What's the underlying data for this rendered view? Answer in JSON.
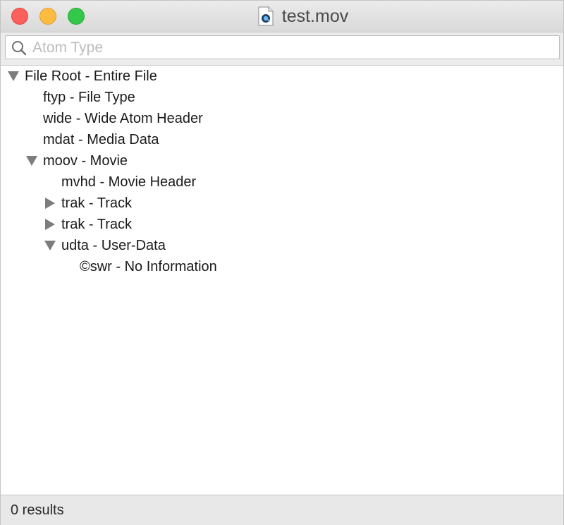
{
  "window": {
    "title": "test.mov",
    "file_icon": "quicktime-document-icon"
  },
  "search": {
    "placeholder": "Atom Type",
    "value": ""
  },
  "tree": {
    "rows": [
      {
        "label": "File Root - Entire File",
        "depth": 0,
        "state": "expanded"
      },
      {
        "label": "ftyp - File Type",
        "depth": 1,
        "state": "leaf"
      },
      {
        "label": "wide - Wide Atom Header",
        "depth": 1,
        "state": "leaf"
      },
      {
        "label": "mdat - Media Data",
        "depth": 1,
        "state": "leaf"
      },
      {
        "label": "moov - Movie",
        "depth": 1,
        "state": "expanded"
      },
      {
        "label": "mvhd - Movie Header",
        "depth": 2,
        "state": "leaf"
      },
      {
        "label": "trak - Track",
        "depth": 2,
        "state": "collapsed"
      },
      {
        "label": "trak - Track",
        "depth": 2,
        "state": "collapsed"
      },
      {
        "label": "udta - User-Data",
        "depth": 2,
        "state": "expanded"
      },
      {
        "label": "©swr - No Information",
        "depth": 3,
        "state": "leaf"
      }
    ]
  },
  "status": {
    "results": "0 results"
  },
  "colors": {
    "close": "#fc605c",
    "minimize": "#fdbc40",
    "maximize": "#34c84a",
    "disclosure": "#7d7d7d"
  }
}
